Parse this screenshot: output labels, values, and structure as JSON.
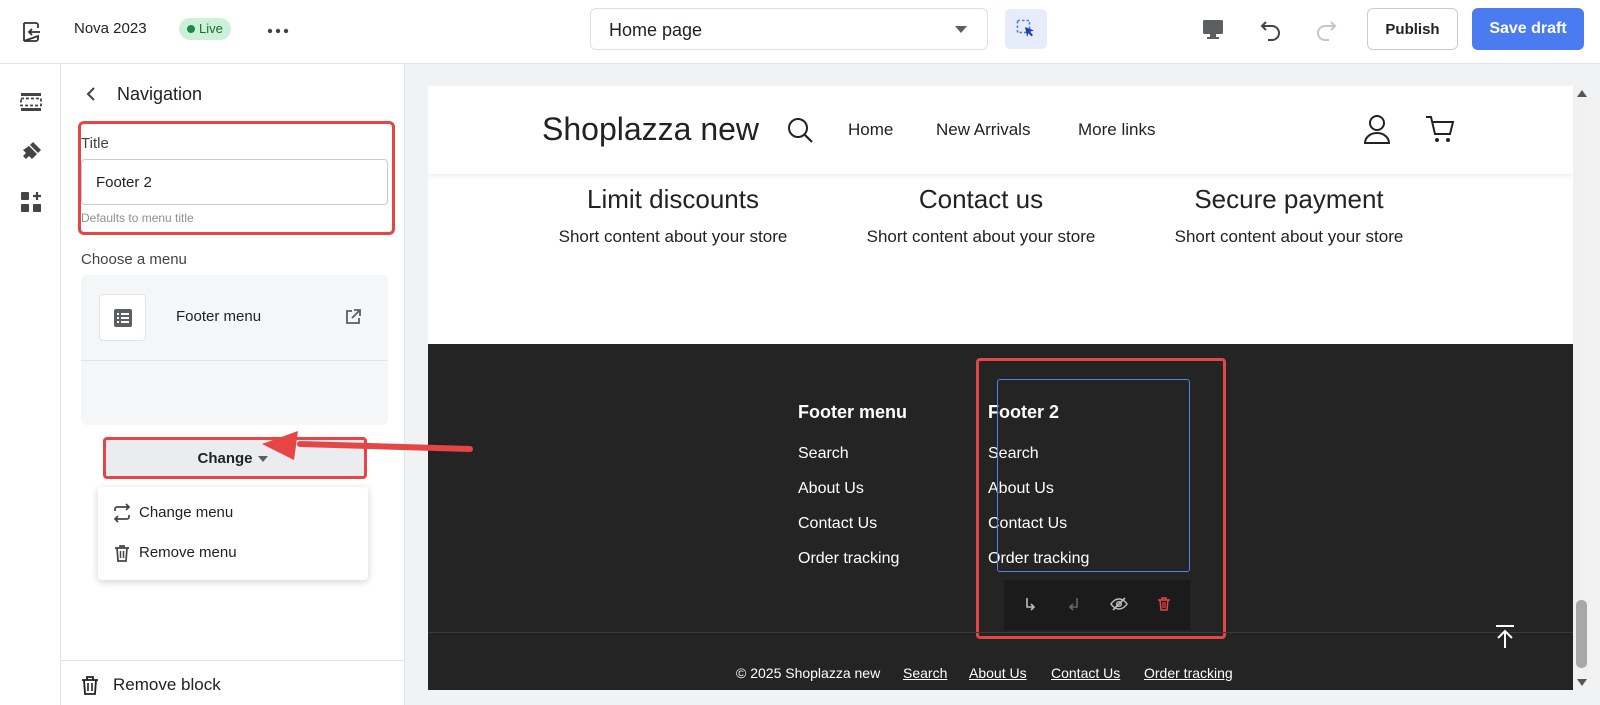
{
  "topbar": {
    "store_name": "Nova 2023",
    "live_badge": "Live",
    "page_select": "Home page",
    "publish_label": "Publish",
    "save_label": "Save draft"
  },
  "panel": {
    "title": "Navigation",
    "field_label": "Title",
    "field_value": "Footer 2",
    "field_hint": "Defaults to menu title",
    "choose_label": "Choose a menu",
    "menu_name": "Footer menu",
    "change_label": "Change",
    "dropdown": [
      {
        "label": "Change menu",
        "icon": "refresh-icon"
      },
      {
        "label": "Remove menu",
        "icon": "trash-icon"
      }
    ],
    "remove_block": "Remove block"
  },
  "preview": {
    "brand": "Shoplazza new",
    "nav": [
      "Home",
      "New Arrivals",
      "More links"
    ],
    "features": [
      {
        "title": "Limit discounts",
        "text": "Short content about your store"
      },
      {
        "title": "Contact us",
        "text": "Short content about your store"
      },
      {
        "title": "Secure payment",
        "text": "Short content about your store"
      }
    ],
    "footer_columns": [
      {
        "heading": "Footer menu",
        "links": [
          "Search",
          "About Us",
          "Contact Us",
          "Order tracking"
        ]
      },
      {
        "heading": "Footer 2",
        "links": [
          "Search",
          "About Us",
          "Contact Us",
          "Order tracking"
        ]
      }
    ],
    "copyright": "© 2025 Shoplazza new",
    "bottom_links": [
      "Search",
      "About Us",
      "Contact Us",
      "Order tracking"
    ]
  },
  "colors": {
    "accent": "#4a7bf0",
    "annotation": "#e64545",
    "footer_bg": "#242424",
    "live_badge_bg": "#cdf0d9"
  }
}
